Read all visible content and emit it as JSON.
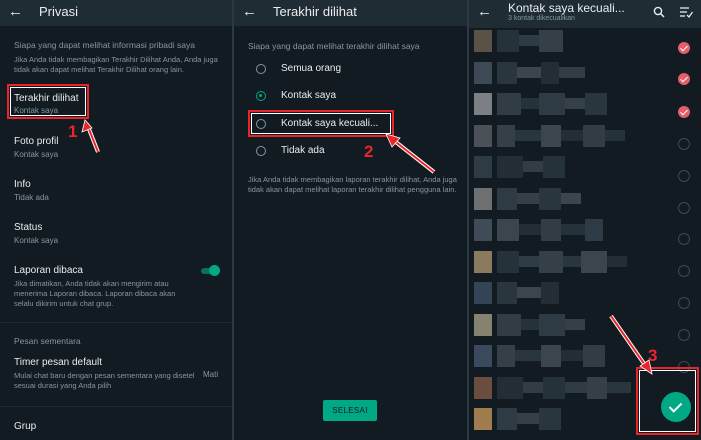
{
  "panel1": {
    "title": "Privasi",
    "section_header": "Siapa yang dapat melihat informasi pribadi saya",
    "section_desc": "Jika Anda tidak membagikan Terakhir Dilihat Anda, Anda juga tidak akan dapat melihat Terakhir Dilihat orang lain.",
    "items": [
      {
        "title": "Terakhir dilihat",
        "value": "Kontak saya"
      },
      {
        "title": "Foto profil",
        "value": "Kontak saya"
      },
      {
        "title": "Info",
        "value": "Tidak ada"
      },
      {
        "title": "Status",
        "value": "Kontak saya"
      }
    ],
    "read_receipts": {
      "title": "Laporan dibaca",
      "desc": "Jika dimatikan, Anda tidak akan mengirim atau menerima Laporan dibaca. Laporan dibaca akan selalu dikirim untuk chat grup.",
      "enabled": true
    },
    "disappearing_header": "Pesan sementara",
    "default_timer": {
      "title": "Timer pesan default",
      "desc": "Mulai chat baru dengan pesan sementara yang disetel sesuai durasi yang Anda pilih",
      "value": "Mati"
    },
    "groups_title": "Grup",
    "annotation": "1"
  },
  "panel2": {
    "title": "Terakhir dilihat",
    "section_header": "Siapa yang dapat melihat terakhir dilihat saya",
    "options": [
      {
        "label": "Semua orang",
        "selected": false
      },
      {
        "label": "Kontak saya",
        "selected": true
      },
      {
        "label": "Kontak saya kecuali...",
        "selected": false
      },
      {
        "label": "Tidak ada",
        "selected": false
      }
    ],
    "note": "Jika Anda tidak membagikan laporan terakhir dilihat, Anda juga tidak akan dapat melihat laporan terakhir dilihat pengguna lain.",
    "done_button": "SELESAI",
    "annotation": "2"
  },
  "panel3": {
    "title": "Kontak saya kecuali...",
    "subtitle": "3 kontak dikecualikan",
    "contacts_selected": [
      true,
      true,
      true,
      false,
      false,
      false,
      false,
      false,
      false,
      false,
      false,
      false
    ],
    "annotation": "3"
  },
  "colors": {
    "accent": "#00a884",
    "annotation_red": "#e8262a",
    "check_red": "#e35d6a",
    "background": "#111b21"
  },
  "icons": [
    "back-arrow-icon",
    "search-icon",
    "select-all-icon",
    "check-icon"
  ]
}
